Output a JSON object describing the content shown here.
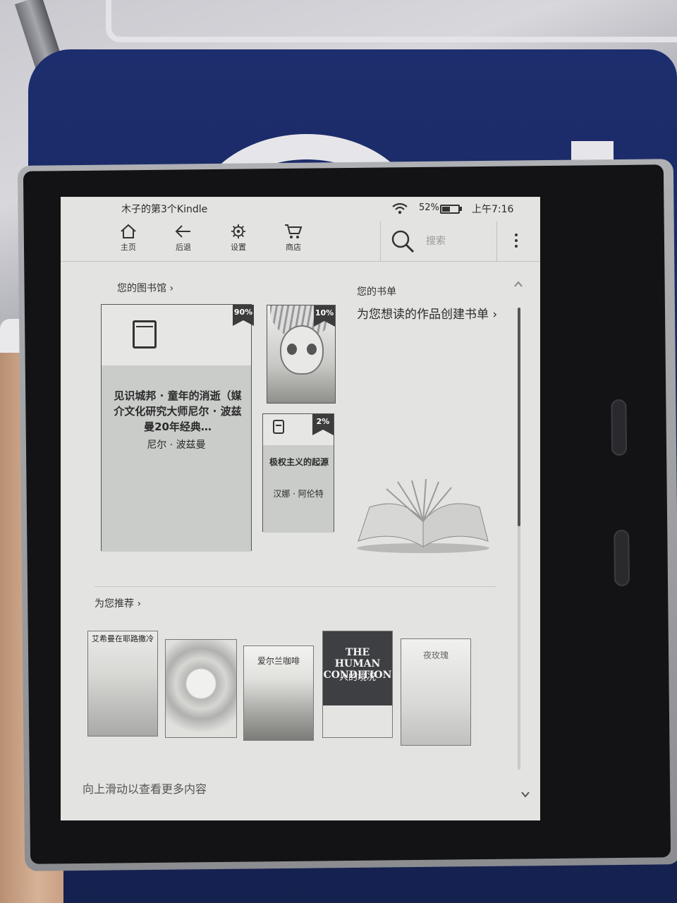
{
  "status": {
    "device_name": "木子的第3个Kindle",
    "battery": "52%",
    "battery_level": 0.52,
    "time": "上午7:16"
  },
  "toolbar": {
    "home_label": "主页",
    "back_label": "后退",
    "settings_label": "设置",
    "store_label": "商店",
    "search_placeholder": "搜索"
  },
  "library": {
    "title": "您的图书馆 ›",
    "books": [
      {
        "title": "见识城邦 · 童年的消逝（媒介文化研究大师尼尔 · 波兹曼20年经典…",
        "author": "尼尔 · 波兹曼",
        "progress_label": "90%"
      },
      {
        "progress_label": "10%"
      },
      {
        "title": "极权主义的起源",
        "author": "汉娜 · 阿伦特",
        "progress_label": "2%"
      }
    ]
  },
  "reading_list": {
    "title": "您的书单",
    "description": "为您想读的作品创建书单 ›"
  },
  "recommendations": {
    "title": "为您推荐 ›",
    "covers": [
      {
        "text": "艾希曼在耶路撒冷"
      },
      {
        "text": ""
      },
      {
        "text": "爱尔兰咖啡"
      },
      {
        "text": "THE HUMAN CONDITION",
        "subtext": "人的境况"
      },
      {
        "text": "夜玫瑰"
      }
    ]
  },
  "footer": {
    "hint": "向上滑动以查看更多内容"
  },
  "colors": {
    "screen_bg": "#e3e4e1",
    "badge": "#3c3c3c",
    "cover_fill": "#c9ccc9"
  }
}
